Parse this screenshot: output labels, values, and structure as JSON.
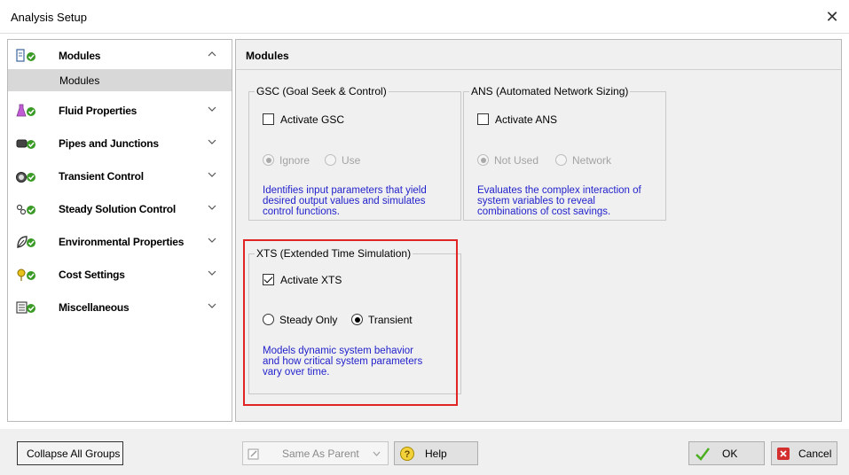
{
  "window": {
    "title": "Analysis Setup"
  },
  "sidebar": {
    "groups": [
      {
        "label": "Modules",
        "icon": "modules-icon",
        "expanded": true,
        "items": [
          {
            "label": "Modules"
          }
        ]
      },
      {
        "label": "Fluid Properties",
        "icon": "flask-icon"
      },
      {
        "label": "Pipes and Junctions",
        "icon": "pipe-icon"
      },
      {
        "label": "Transient Control",
        "icon": "stopwatch-icon"
      },
      {
        "label": "Steady Solution Control",
        "icon": "solution-icon"
      },
      {
        "label": "Environmental Properties",
        "icon": "leaf-icon"
      },
      {
        "label": "Cost Settings",
        "icon": "cost-icon"
      },
      {
        "label": "Miscellaneous",
        "icon": "misc-icon"
      }
    ]
  },
  "panel": {
    "header": "Modules",
    "gsc": {
      "legend": "GSC (Goal Seek & Control)",
      "activate_label": "Activate GSC",
      "activated": false,
      "options": [
        "Ignore",
        "Use"
      ],
      "selected": "Ignore",
      "description_lines": [
        "Identifies input parameters that yield",
        "desired output values and simulates",
        "control functions."
      ]
    },
    "ans": {
      "legend": "ANS (Automated Network Sizing)",
      "activate_label": "Activate ANS",
      "activated": false,
      "options": [
        "Not Used",
        "Network"
      ],
      "selected": "Not Used",
      "description_lines": [
        "Evaluates the complex interaction of",
        "system variables to reveal",
        "combinations of cost savings."
      ]
    },
    "xts": {
      "legend": "XTS (Extended Time Simulation)",
      "activate_label": "Activate XTS",
      "activated": true,
      "options": [
        "Steady Only",
        "Transient"
      ],
      "selected": "Transient",
      "description_lines": [
        "Models dynamic system behavior",
        "and how critical system parameters",
        "vary over time."
      ]
    }
  },
  "footer": {
    "collapse_label": "Collapse All Groups",
    "same_as_parent_label": "Same As Parent",
    "help_label": "Help",
    "ok_label": "OK",
    "cancel_label": "Cancel"
  },
  "colors": {
    "highlight": "#e02323",
    "description_text": "#2222cc",
    "ok_check": "#4caf20",
    "cancel_x": "#d32f2f"
  }
}
